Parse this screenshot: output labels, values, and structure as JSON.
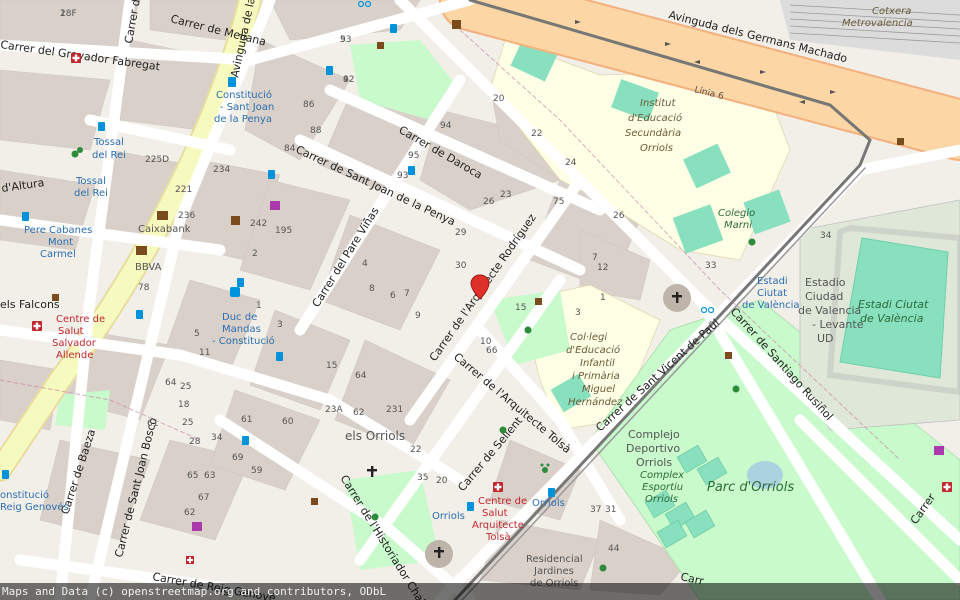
{
  "attribution": "Maps and Data (c) openstreetmap.org and contributors, ODbL",
  "streets": {
    "gravador": "Carrer del Gravador Fabregat",
    "cid": "Carrer del Cid",
    "meliana": "Carrer de Meliana",
    "sant_joan_penya": "Carrer de Sant Joan de la Penya",
    "daroca": "Carrer de Daroca",
    "pare_vinas": "Carrer del Pare Viñas",
    "arquitecte_rodriguez": "Carrer de l'Arquitecte Rodríguez",
    "arquitecte_tolsa": "Carrer de l'Arquitecte Tolsà",
    "sellent": "Carrer de Sellent",
    "historiador_chabret": "Carrer de l'Historiador Chabret",
    "baeza": "Carrer de Baeza",
    "sant_joan_bosco": "Carrer de Sant Joan Bosco",
    "reig_genove": "Carrer de Reig Genové",
    "sant_vicent": "Carrer de Sant Vicent de Paül",
    "santiago_rusinol": "Carrer de Santiago Rusiñol",
    "germans_machado": "Avinguda dels Germans Machado",
    "avinguda_la": "Avinguda de la",
    "altura": "d'Altura",
    "falcons": "els Falcons",
    "carrer_right": "Carrer",
    "carrer_bottom": "Carr"
  },
  "places": {
    "orriols_district": "els Orriols",
    "cotxera": "Cotxera",
    "metrovalencia": "Metrovalencia",
    "linia6": "Línia 6",
    "institut_l1": "Institut",
    "institut_l2": "d'Educació",
    "institut_l3": "Secundària",
    "institut_l4": "Orriols",
    "colegio_l1": "Colegio",
    "colegio_l2": "Marni",
    "estadi_l1": "Estadi",
    "estadi_l2": "Ciutat",
    "estadi_l3": "de València",
    "estadio_l1": "Estadio",
    "estadio_l2": "Ciudad",
    "estadio_l3": "de Valencia",
    "estadio_l4": "- Levante",
    "estadio_l5": "UD",
    "estadi_green_l1": "Estadi Ciutat",
    "estadi_green_l2": "de València",
    "collegi_l1": "Col·legi",
    "collegi_l2": "d'Educació",
    "collegi_l3": "Infantil",
    "collegi_l4": "i Primària",
    "collegi_l5": "Miguel",
    "collegi_l6": "Hernández",
    "complejo_l1": "Complejo",
    "complejo_l2": "Deportivo",
    "complejo_l3": "Orriols",
    "complex_l1": "Complex",
    "complex_l2": "Esportiu",
    "complex_l3": "Orriols",
    "parc": "Parc d'Orriols",
    "constitucio_sj_l1": "Constitució",
    "constitucio_sj_l2": "- Sant Joan",
    "constitucio_sj_l3": "de la Penya",
    "tossal_l1": "Tossal",
    "tossal_l2": "del Rei",
    "tossal2_l1": "Tossal",
    "tossal2_l2": "del Rei",
    "pere_l1": "Pere Cabanes",
    "pere_l2": "Mont",
    "pere_l3": "Carmel",
    "caixabank": "Caixabank",
    "bbva": "BBVA",
    "centre_salvador_l1": "Centre de",
    "centre_salvador_l2": "Salut",
    "centre_salvador_l3": "Salvador",
    "centre_salvador_l4": "Allende",
    "duc_l1": "Duc de",
    "duc_l2": "Mandas",
    "duc_l3": "- Constitució",
    "centre_tolsa_l1": "Centre de",
    "centre_tolsa_l2": "Salut",
    "centre_tolsa_l3": "Arquitecte",
    "centre_tolsa_l4": "Tolsà",
    "orriols_stop": "Orriols",
    "orriols_stop2": "Orriols",
    "residencial_l1": "Residencial",
    "residencial_l2": "Jardines",
    "residencial_l3": "de Orriols",
    "constitucio_bottom_l1": "onstitució",
    "constitucio_bottom_l2": "Reig Genovés"
  },
  "numbers": [
    "18F",
    "93",
    "92",
    "86",
    "88",
    "84",
    "94",
    "95",
    "93",
    "20",
    "22",
    "24",
    "23",
    "26",
    "29",
    "30",
    "75",
    "26",
    "225D",
    "221",
    "236",
    "234",
    "242",
    "78",
    "195",
    "2",
    "4",
    "6",
    "7",
    "8",
    "9",
    "1",
    "3",
    "5",
    "11",
    "15",
    "64",
    "62",
    "23A",
    "231",
    "22",
    "20",
    "35",
    "34",
    "33",
    "37",
    "31",
    "44",
    "25",
    "18",
    "25",
    "28",
    "34",
    "61",
    "63",
    "65",
    "67",
    "69",
    "59",
    "60",
    "61",
    "62",
    "64",
    "66",
    "10",
    "15",
    "12",
    "1",
    "3",
    "7",
    "2",
    "5",
    "4"
  ],
  "colors": {
    "background": "#f2efe9",
    "building": "#d9d0c9",
    "road_major": "#f7fabf",
    "road_trunk": "#fcd6a4",
    "park": "#c8facc",
    "pitch": "#88e0be",
    "school": "#ffffe5",
    "rail": "#777777",
    "marker": "#e0302a",
    "hospital": "#c2262e",
    "poi_blue": "#0092da"
  },
  "marker": {
    "name": "location-marker-icon"
  }
}
